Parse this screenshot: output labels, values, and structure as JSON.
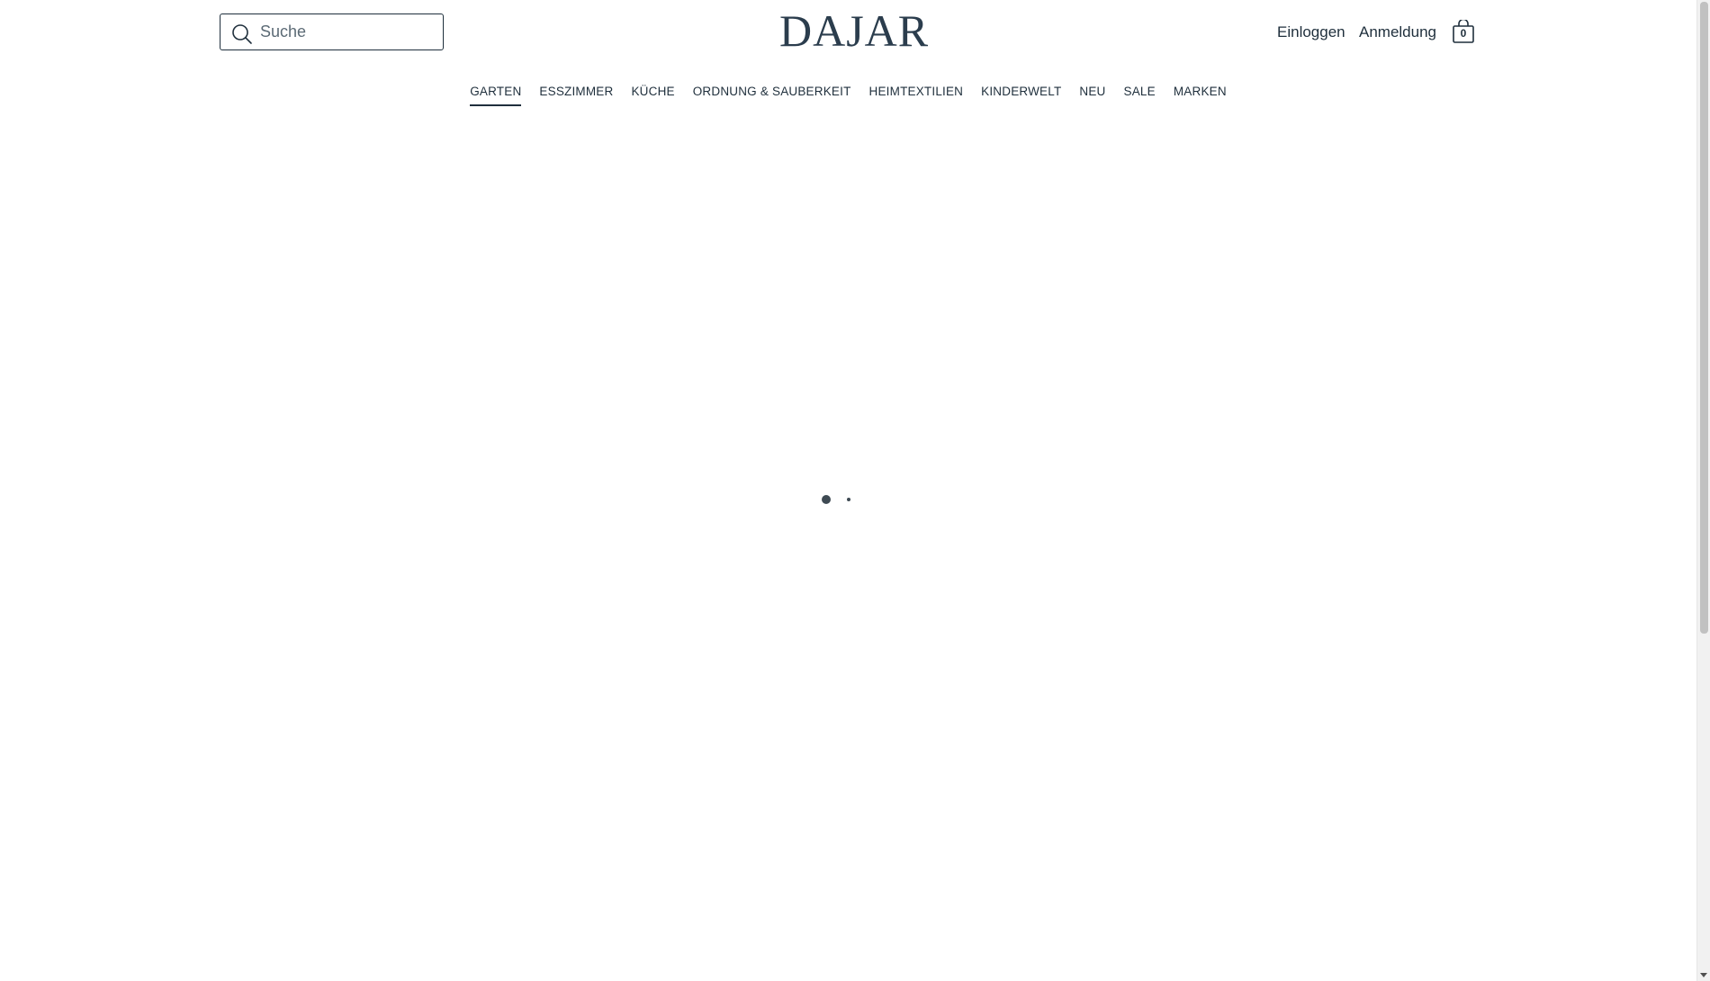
{
  "header": {
    "search": {
      "placeholder": "Suche",
      "value": ""
    },
    "logo": "DAJAR",
    "account": {
      "login": "Einloggen",
      "register": "Anmeldung"
    },
    "cart": {
      "count": "0"
    }
  },
  "nav": {
    "items": [
      {
        "label": "GARTEN",
        "active": true
      },
      {
        "label": "ESSZIMMER"
      },
      {
        "label": "KÜCHE"
      },
      {
        "label": "ORDNUNG & SAUBERKEIT"
      },
      {
        "label": "HEIMTEXTILIEN"
      },
      {
        "label": "KINDERWELT"
      },
      {
        "label": "NEU"
      },
      {
        "label": "SALE"
      },
      {
        "label": "MARKEN"
      }
    ]
  },
  "carousel": {
    "slide_count": 2,
    "active_index": 0
  },
  "colors": {
    "text": "#1f2f3c",
    "logo": "#2b3d4d",
    "background": "#ffffff"
  }
}
